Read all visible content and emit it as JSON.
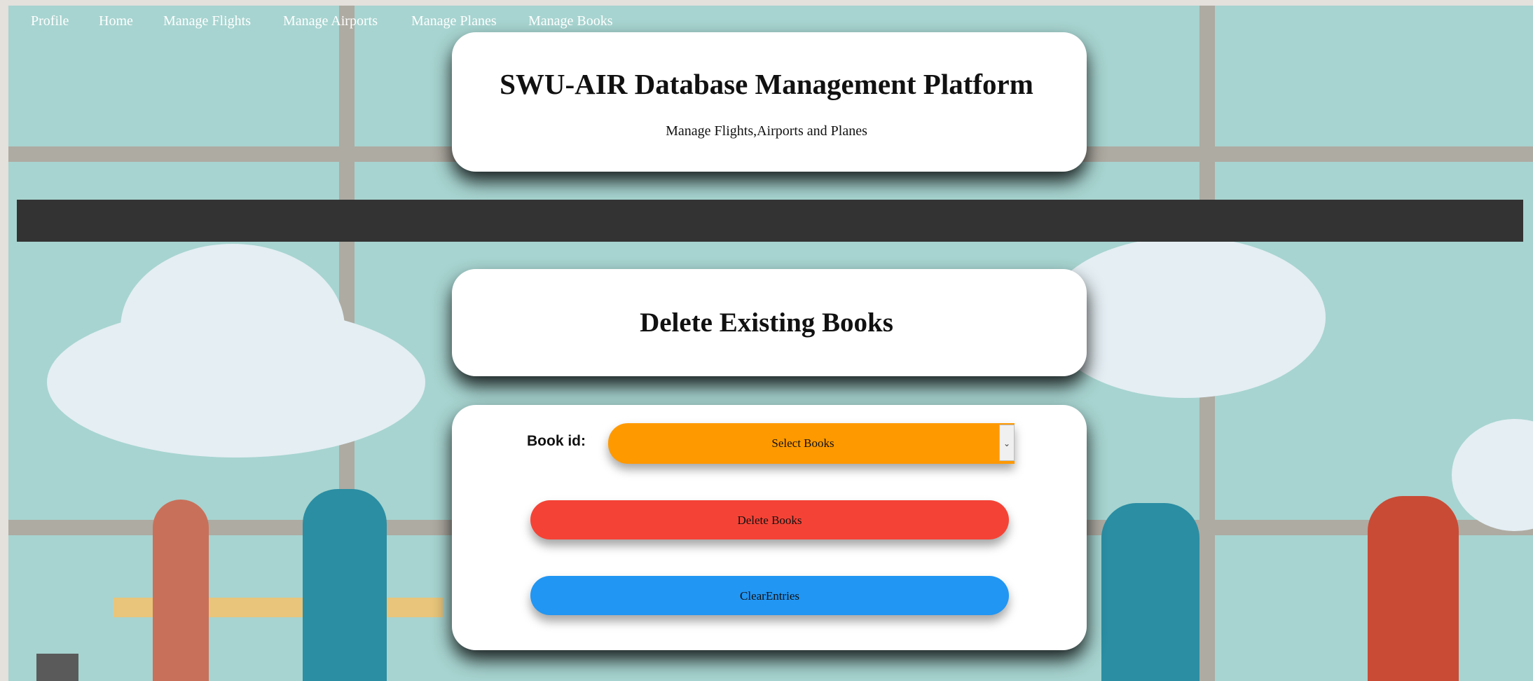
{
  "header": {
    "title": "SWU-AIR Database Management Platform",
    "subtitle": "Manage Flights,Airports and Planes"
  },
  "navbar": {
    "items": [
      {
        "label": "Profile"
      },
      {
        "label": "Home"
      },
      {
        "label": "Manage Flights"
      },
      {
        "label": "Manage Airports"
      },
      {
        "label": "Manage Planes"
      },
      {
        "label": "Manage Books"
      }
    ]
  },
  "page": {
    "title": "Delete Existing Books"
  },
  "form": {
    "book_id_label": "Book id:",
    "select_value": "Select Books",
    "delete_label": "Delete Books",
    "clear_label": "ClearEntries"
  },
  "colors": {
    "navbar": "#333333",
    "select": "#ff9900",
    "delete_button": "#f44336",
    "clear_button": "#2196f3",
    "background": "#a7d4d0"
  }
}
